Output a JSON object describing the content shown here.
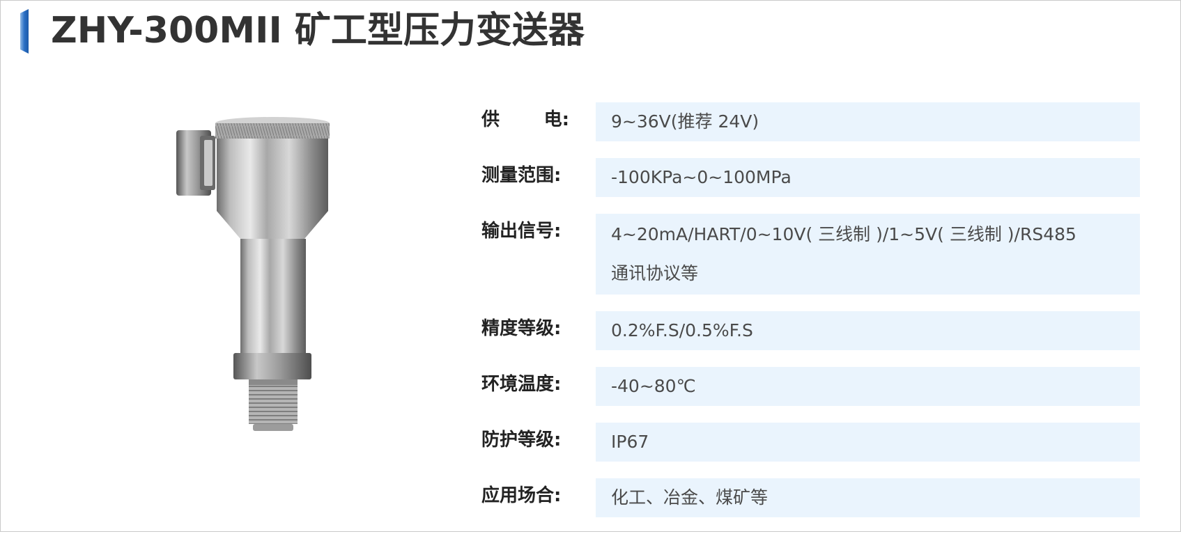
{
  "header": {
    "title": "ZHY-300MII 矿工型压力变送器",
    "accent_color": "#2a6fc4"
  },
  "product_image": {
    "icon": "pressure-transmitter-icon"
  },
  "specs": [
    {
      "label_a": "供",
      "label_b": "电:",
      "value": "9~36V(推荐 24V)"
    },
    {
      "label": "测量范围:",
      "value": "-100KPa~0~100MPa"
    },
    {
      "label": "输出信号:",
      "value_line1": "4~20mA/HART/0~10V( 三线制 )/1~5V( 三线制 )/RS485",
      "value_line2": "通讯协议等"
    },
    {
      "label": "精度等级:",
      "value": "0.2%F.S/0.5%F.S"
    },
    {
      "label": "环境温度:",
      "value": "-40~80℃"
    },
    {
      "label": "防护等级:",
      "value": "IP67"
    },
    {
      "label": "应用场合:",
      "value": "化工、冶金、煤矿等"
    }
  ],
  "colors": {
    "value_background": "#eaf4fd",
    "title_text": "#333333"
  }
}
